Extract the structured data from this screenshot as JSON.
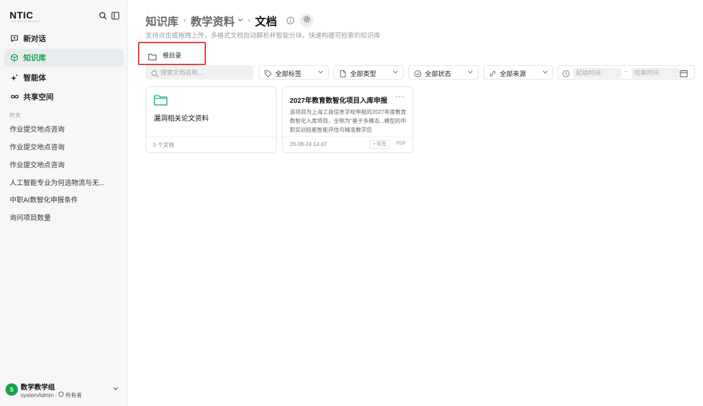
{
  "sidebar": {
    "logo": "NTIC",
    "logo_tagline": "New Tech for Education",
    "nav": [
      {
        "label": "新对话",
        "icon": "chat-icon"
      },
      {
        "label": "知识库",
        "icon": "cube-icon",
        "active": true
      },
      {
        "label": "智能体",
        "icon": "sparkle-icon"
      },
      {
        "label": "共享空间",
        "icon": "infinity-icon"
      }
    ],
    "history_label": "昨天",
    "history": [
      "作业提交地点咨询",
      "作业提交地点咨询",
      "作业提交地点咨询",
      "人工智能专业为何选物流与无...",
      "中职AI数智化申报条件",
      "询问项目数量"
    ],
    "user": {
      "avatar": "S",
      "name": "数学教学组",
      "account": "systemAdmin",
      "role": "所有者"
    }
  },
  "breadcrumb": {
    "root": "知识库",
    "parent": "教学资料",
    "current": "文档"
  },
  "subtitle": "支持点击或拖拽上传，多格式文档自动解析并智能分块，快速构建可检索的知识库",
  "folder_chip": "根目录",
  "search": {
    "placeholder": "搜索文档名称..."
  },
  "filters": {
    "tags": "全部标签",
    "types": "全部类型",
    "status": "全部状态",
    "source": "全部来源"
  },
  "date_range": {
    "start_placeholder": "起始时间",
    "separator": "-",
    "end_placeholder": "结束时间"
  },
  "folder_card": {
    "title": "漏洞相关论文资料",
    "count": "5 个文档"
  },
  "doc_card": {
    "title": "2027年教育数智化项目入库申报",
    "menu": "···",
    "description": "该项目为上海工商信息学校申报的2027年度教育数智化入库项目，全称为\"基于多模态...模型的中职实训技能智能评估与精准教学应",
    "date": "26-08-24 14:47",
    "tag_button": "+ 标签",
    "file_type": "PDF"
  },
  "colors": {
    "accent": "#16a34a",
    "highlight_box": "#e53e3e",
    "folder": "#3ec28f"
  }
}
